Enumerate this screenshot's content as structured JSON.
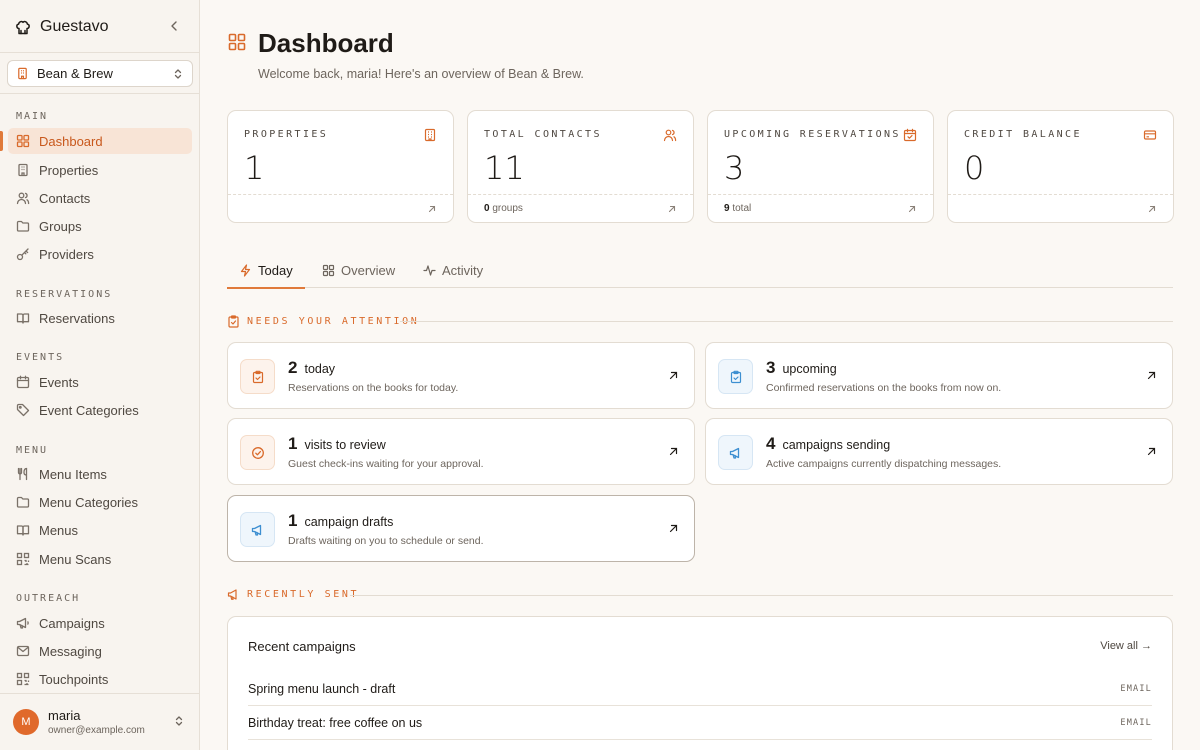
{
  "app": {
    "name": "Guestavo"
  },
  "property_selector": {
    "value": "Bean & Brew"
  },
  "nav": {
    "main_label": "MAIN",
    "dashboard": "Dashboard",
    "properties": "Properties",
    "contacts": "Contacts",
    "groups": "Groups",
    "providers": "Providers",
    "reservations_label": "RESERVATIONS",
    "reservations": "Reservations",
    "events_label": "EVENTS",
    "events": "Events",
    "event_categories": "Event Categories",
    "menu_label": "MENU",
    "menu_items": "Menu Items",
    "menu_categories": "Menu Categories",
    "menus": "Menus",
    "menu_scans": "Menu Scans",
    "outreach_label": "OUTREACH",
    "campaigns": "Campaigns",
    "messaging": "Messaging",
    "touchpoints": "Touchpoints"
  },
  "user": {
    "initial": "M",
    "name": "maria",
    "email": "owner@example.com"
  },
  "page": {
    "title": "Dashboard",
    "subtitle": "Welcome back, maria! Here's an overview of Bean & Brew."
  },
  "stats": {
    "properties": {
      "label": "PROPERTIES",
      "value": "1",
      "icon": "building-icon"
    },
    "contacts": {
      "label": "TOTAL CONTACTS",
      "value": "11",
      "foot_num": "0",
      "foot_text": "groups",
      "icon": "users-icon"
    },
    "reservations": {
      "label": "UPCOMING RESERVATIONS",
      "value": "3",
      "foot_num": "9",
      "foot_text": "total",
      "icon": "calendar-check-icon"
    },
    "credit": {
      "label": "CREDIT BALANCE",
      "value": "0",
      "icon": "credit-card-icon"
    }
  },
  "tabs": {
    "today": "Today",
    "overview": "Overview",
    "activity": "Activity"
  },
  "attention": {
    "heading": "NEEDS YOUR ATTENTION",
    "today": {
      "num": "2",
      "title": "today",
      "desc": "Reservations on the books for today."
    },
    "upcoming": {
      "num": "3",
      "title": "upcoming",
      "desc": "Confirmed reservations on the books from now on."
    },
    "visits": {
      "num": "1",
      "title": "visits to review",
      "desc": "Guest check-ins waiting for your approval."
    },
    "sending": {
      "num": "4",
      "title": "campaigns sending",
      "desc": "Active campaigns currently dispatching messages."
    },
    "drafts": {
      "num": "1",
      "title": "campaign drafts",
      "desc": "Drafts waiting on you to schedule or send."
    }
  },
  "recent": {
    "heading": "RECENTLY SENT",
    "title": "Recent campaigns",
    "view_all": "View all →",
    "rows": [
      {
        "name": "Spring menu launch - draft",
        "tag": "EMAIL"
      },
      {
        "name": "Birthday treat: free coffee on us",
        "tag": "EMAIL"
      }
    ]
  },
  "colors": {
    "accent": "#e07a3a",
    "accent_text": "#c8581c",
    "info_blue": "#3d8fd1",
    "background": "#fbf8f4"
  }
}
